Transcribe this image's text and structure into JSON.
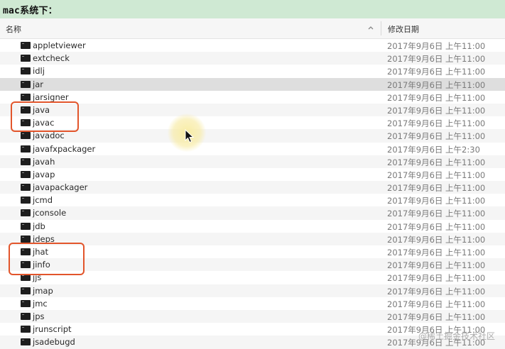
{
  "banner": {
    "text": "mac系统下："
  },
  "header": {
    "name_label": "名称",
    "date_label": "修改日期"
  },
  "files": [
    {
      "name": "appletviewer",
      "date": "2017年9月6日 上午11:00"
    },
    {
      "name": "extcheck",
      "date": "2017年9月6日 上午11:00"
    },
    {
      "name": "idlj",
      "date": "2017年9月6日 上午11:00"
    },
    {
      "name": "jar",
      "date": "2017年9月6日 上午11:00"
    },
    {
      "name": "jarsigner",
      "date": "2017年9月6日 上午11:00"
    },
    {
      "name": "java",
      "date": "2017年9月6日 上午11:00"
    },
    {
      "name": "javac",
      "date": "2017年9月6日 上午11:00"
    },
    {
      "name": "javadoc",
      "date": "2017年9月6日 上午11:00"
    },
    {
      "name": "javafxpackager",
      "date": "2017年9月6日 上午2:30"
    },
    {
      "name": "javah",
      "date": "2017年9月6日 上午11:00"
    },
    {
      "name": "javap",
      "date": "2017年9月6日 上午11:00"
    },
    {
      "name": "javapackager",
      "date": "2017年9月6日 上午11:00"
    },
    {
      "name": "jcmd",
      "date": "2017年9月6日 上午11:00"
    },
    {
      "name": "jconsole",
      "date": "2017年9月6日 上午11:00"
    },
    {
      "name": "jdb",
      "date": "2017年9月6日 上午11:00"
    },
    {
      "name": "jdeps",
      "date": "2017年9月6日 上午11:00"
    },
    {
      "name": "jhat",
      "date": "2017年9月6日 上午11:00"
    },
    {
      "name": "jinfo",
      "date": "2017年9月6日 上午11:00"
    },
    {
      "name": "jjs",
      "date": "2017年9月6日 上午11:00"
    },
    {
      "name": "jmap",
      "date": "2017年9月6日 上午11:00"
    },
    {
      "name": "jmc",
      "date": "2017年9月6日 上午11:00"
    },
    {
      "name": "jps",
      "date": "2017年9月6日 上午11:00"
    },
    {
      "name": "jrunscript",
      "date": "2017年9月6日 上午11:00"
    },
    {
      "name": "jsadebugd",
      "date": "2017年9月6日 上午11:00"
    }
  ],
  "icons": {
    "file": "executable-file-icon",
    "sort": "chevron-up-icon",
    "cursor": "mouse-pointer-icon"
  },
  "colors": {
    "banner": "#cfe9d3",
    "highlight": "#e2552b"
  },
  "watermark": "@稀土掘金技术社区"
}
